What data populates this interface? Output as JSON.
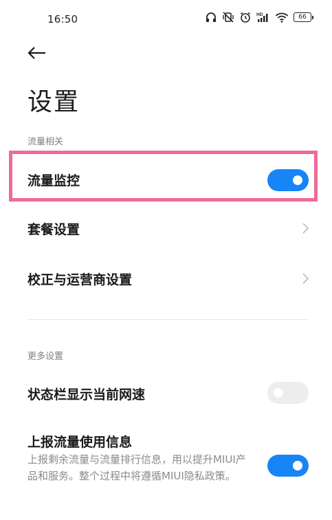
{
  "status_bar": {
    "time": "16:50",
    "icons": [
      "headphones-icon",
      "vibrate-off-icon",
      "alarm-icon",
      "hd-signal-icon",
      "wifi-icon",
      "battery-icon"
    ],
    "battery_level": "66"
  },
  "header": {
    "back_icon": "arrow-left-icon",
    "title": "设置"
  },
  "sections": [
    {
      "label": "流量相关",
      "items": [
        {
          "title": "流量监控",
          "control": "toggle",
          "state": "on"
        },
        {
          "title": "套餐设置",
          "control": "chevron"
        },
        {
          "title": "校正与运营商设置",
          "control": "chevron"
        }
      ]
    },
    {
      "label": "更多设置",
      "items": [
        {
          "title": "状态栏显示当前网速",
          "control": "toggle",
          "state": "off"
        },
        {
          "title": "上报流量使用信息",
          "description": "上报剩余流量与流量排行信息，用以提升MIUI产品和服务。整个过程中将遵循MIUI隐私政策。",
          "control": "toggle",
          "state": "on"
        }
      ]
    }
  ],
  "colors": {
    "accent": "#1785f5",
    "highlight": "#ee6b97",
    "toggle_off": "#ededed",
    "secondary_text": "#8a8a8a"
  }
}
